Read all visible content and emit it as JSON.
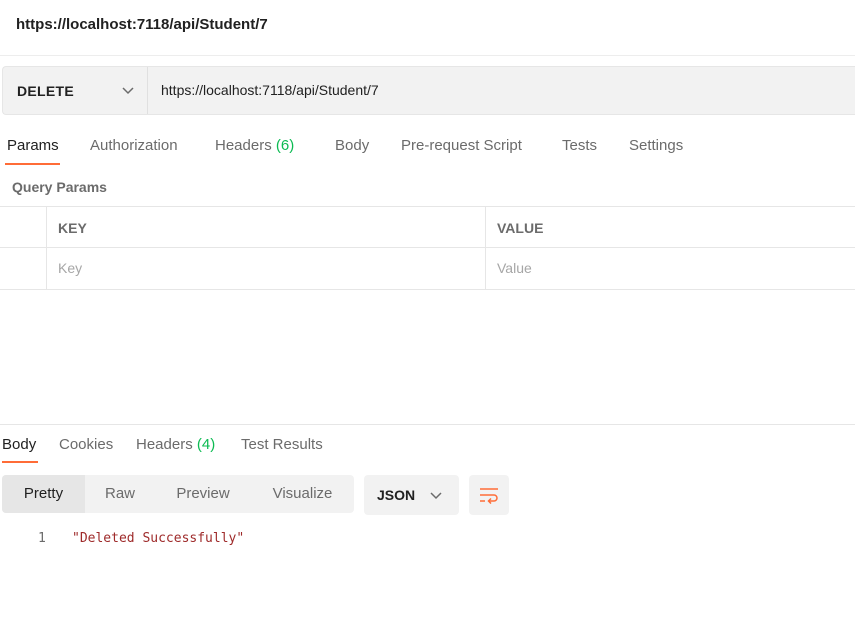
{
  "request": {
    "title": "https://localhost:7118/api/Student/7",
    "method": "DELETE",
    "url": "https://localhost:7118/api/Student/7"
  },
  "request_tabs": [
    {
      "label": "Params",
      "active": true
    },
    {
      "label": "Authorization"
    },
    {
      "label": "Headers",
      "count": "(6)"
    },
    {
      "label": "Body"
    },
    {
      "label": "Pre-request Script"
    },
    {
      "label": "Tests"
    },
    {
      "label": "Settings"
    }
  ],
  "query_params": {
    "label": "Query Params",
    "columns": [
      "KEY",
      "VALUE"
    ],
    "key_placeholder": "Key",
    "value_placeholder": "Value"
  },
  "response_tabs": [
    {
      "label": "Body",
      "active": true
    },
    {
      "label": "Cookies"
    },
    {
      "label": "Headers",
      "count": "(4)"
    },
    {
      "label": "Test Results"
    }
  ],
  "view_modes": [
    {
      "label": "Pretty",
      "active": true
    },
    {
      "label": "Raw"
    },
    {
      "label": "Preview"
    },
    {
      "label": "Visualize"
    }
  ],
  "format": {
    "selected": "JSON"
  },
  "response_body": {
    "lines": [
      {
        "number": "1",
        "text": "\"Deleted Successfully\""
      }
    ]
  },
  "colors": {
    "accent": "#ff6c37",
    "count_green": "#0cbb52",
    "string_red": "#9e2a2a",
    "icons": [
      "chevron-down-icon",
      "wrap-lines-icon"
    ]
  }
}
